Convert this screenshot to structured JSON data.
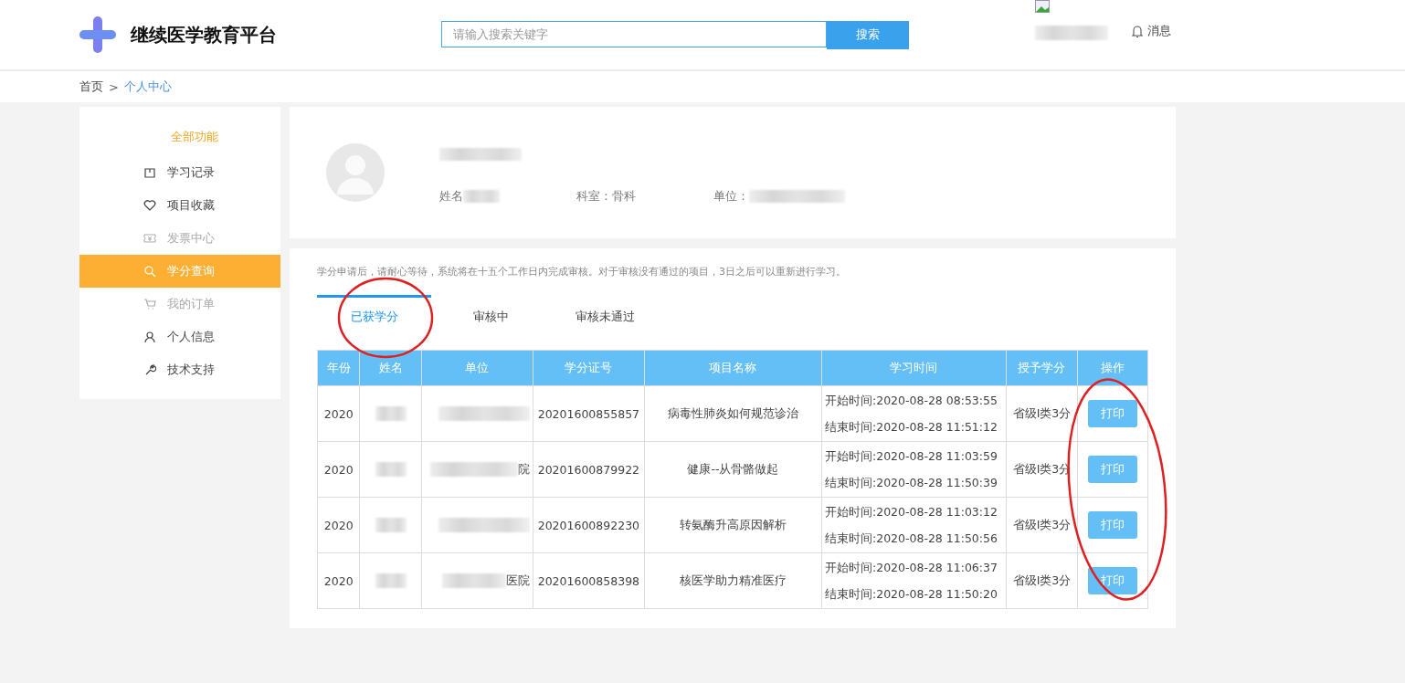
{
  "header": {
    "title": "继续医学教育平台",
    "search": {
      "placeholder": "请输入搜索关键字",
      "button": "搜索"
    },
    "messages": "消息"
  },
  "breadcrumb": {
    "separator": ">",
    "items": [
      {
        "label": "首页",
        "selected": false
      },
      {
        "label": "个人中心",
        "selected": true
      }
    ]
  },
  "sidebar": {
    "heading": "全部功能",
    "items": [
      {
        "label": "学习记录",
        "kind": "book",
        "selected": false,
        "disabled": false
      },
      {
        "label": "项目收藏",
        "kind": "heart",
        "selected": false,
        "disabled": false
      },
      {
        "label": "发票中心",
        "kind": "ticket",
        "selected": false,
        "disabled": true
      },
      {
        "label": "学分查询",
        "kind": "search",
        "selected": true,
        "disabled": false
      },
      {
        "label": "我的订单",
        "kind": "cart",
        "selected": false,
        "disabled": true
      },
      {
        "label": "个人信息",
        "kind": "user",
        "selected": false,
        "disabled": false
      },
      {
        "label": "技术支持",
        "kind": "wrench",
        "selected": false,
        "disabled": false
      }
    ]
  },
  "profile": {
    "fields": [
      {
        "label": "姓名"
      },
      {
        "label": "科室：骨科"
      },
      {
        "label": "单位："
      }
    ]
  },
  "notice": "学分申请后，请耐心等待，系统将在十五个工作日内完成审核。对于审核没有通过的项目，3日之后可以重新进行学习。",
  "tabs": [
    {
      "label": "已获学分",
      "selected": true
    },
    {
      "label": "审核中",
      "selected": false
    },
    {
      "label": "审核未通过",
      "selected": false
    }
  ],
  "table": {
    "columns": [
      "年份",
      "姓名",
      "单位",
      "学分证号",
      "项目名称",
      "学习时间",
      "授予学分",
      "操作"
    ],
    "rows": [
      {
        "year": "2020",
        "unit_tail": "",
        "cert": "20201600855857",
        "project": "病毒性肺炎如何规范诊治",
        "start": "开始时间:2020-08-28 08:53:55",
        "end": "结束时间:2020-08-28 11:51:12",
        "credit": "省级I类3分",
        "action": "打印"
      },
      {
        "year": "2020",
        "unit_tail": "院",
        "cert": "20201600879922",
        "project": "健康--从骨骼做起",
        "start": "开始时间:2020-08-28 11:03:59",
        "end": "结束时间:2020-08-28 11:50:39",
        "credit": "省级I类3分",
        "action": "打印"
      },
      {
        "year": "2020",
        "unit_tail": "",
        "cert": "20201600892230",
        "project": "转氨酶升高原因解析",
        "start": "开始时间:2020-08-28 11:03:12",
        "end": "结束时间:2020-08-28 11:50:56",
        "credit": "省级I类3分",
        "action": "打印"
      },
      {
        "year": "2020",
        "unit_tail": "医院",
        "cert": "20201600858398",
        "project": "核医学助力精准医疗",
        "start": "开始时间:2020-08-28 11:06:37",
        "end": "结束时间:2020-08-28 11:50:20",
        "credit": "省级I类3分",
        "action": "打印"
      }
    ]
  }
}
